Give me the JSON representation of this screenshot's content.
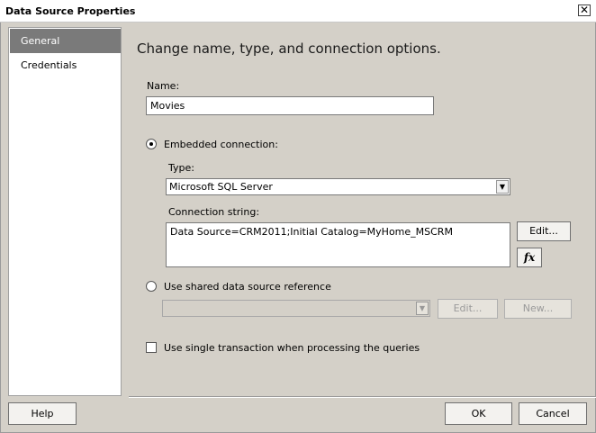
{
  "window": {
    "title": "Data Source Properties",
    "close_glyph": "✕"
  },
  "sidebar": {
    "items": [
      {
        "label": "General",
        "active": true
      },
      {
        "label": "Credentials",
        "active": false
      }
    ]
  },
  "main": {
    "heading": "Change name, type, and connection options.",
    "name_label": "Name:",
    "name_value": "Movies",
    "embedded_label": "Embedded connection:",
    "type_label": "Type:",
    "type_value": "Microsoft SQL Server",
    "conn_label": "Connection string:",
    "conn_value": "Data Source=CRM2011;Initial Catalog=MyHome_MSCRM",
    "edit_label": "Edit...",
    "fx_label": "fx",
    "shared_label": "Use shared data source reference",
    "shared_value": "",
    "shared_edit_label": "Edit...",
    "shared_new_label": "New...",
    "single_tx_label": "Use single transaction when processing the queries"
  },
  "footer": {
    "help_label": "Help",
    "ok_label": "OK",
    "cancel_label": "Cancel"
  }
}
